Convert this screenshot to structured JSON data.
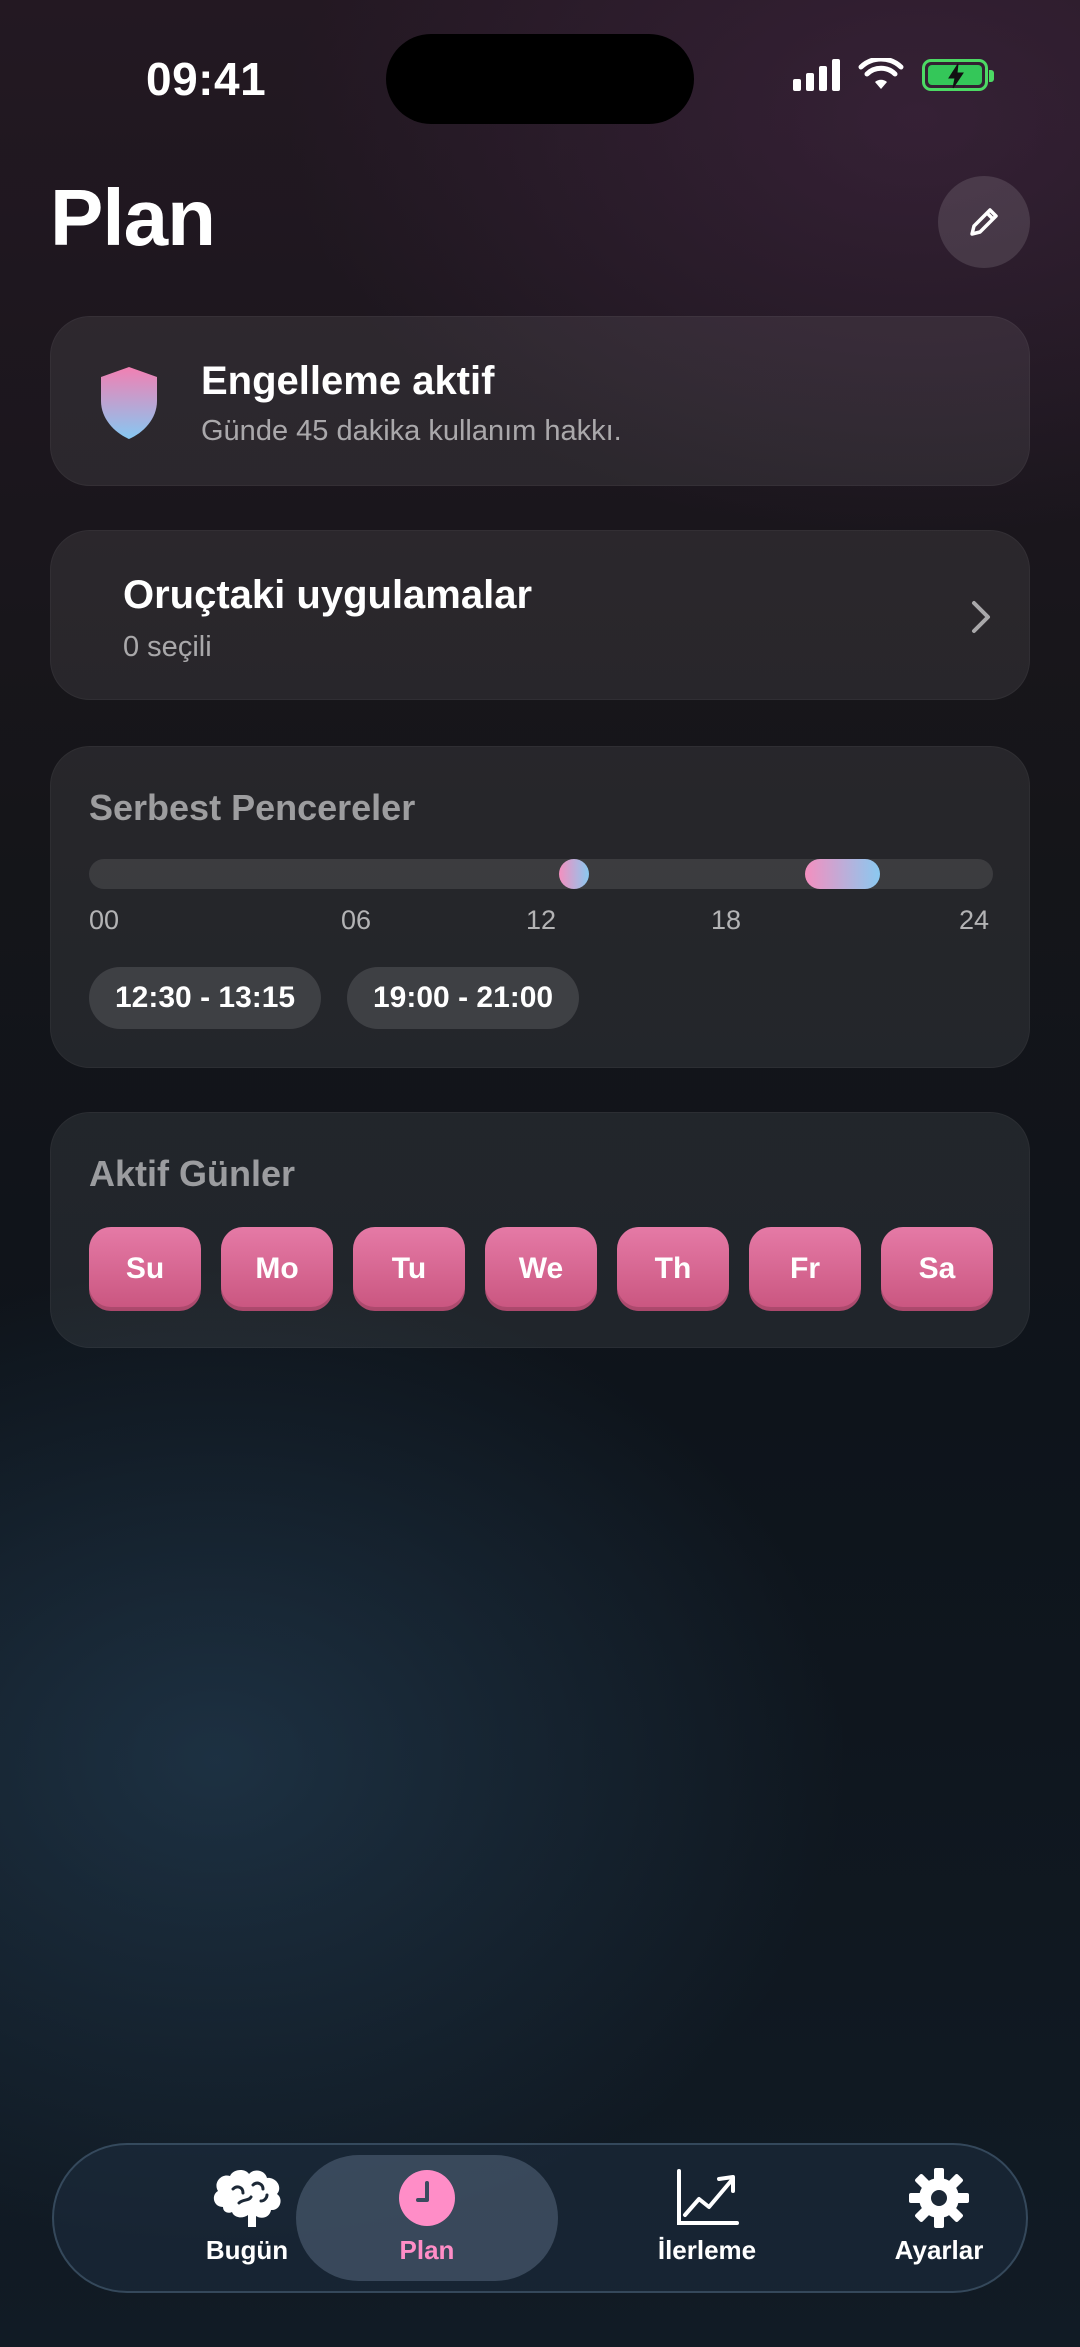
{
  "status_bar": {
    "time": "09:41"
  },
  "header": {
    "title": "Plan",
    "edit_icon": "pencil-icon"
  },
  "blocking": {
    "title": "Engelleme aktif",
    "subtitle": "Günde 45 dakika kullanım hakkı.",
    "icon": "shield-icon"
  },
  "fasting_apps": {
    "title": "Oruçtaki uygulamalar",
    "subtitle": "0 seçili"
  },
  "free_windows": {
    "title": "Serbest Pencereler",
    "ticks": [
      "00",
      "06",
      "12",
      "18",
      "24"
    ],
    "windows": [
      {
        "label": "12:30 - 13:15",
        "start_hour": 12.5,
        "end_hour": 13.25
      },
      {
        "label": "19:00 - 21:00",
        "start_hour": 19.0,
        "end_hour": 21.0
      }
    ]
  },
  "active_days": {
    "title": "Aktif Günler",
    "days": [
      "Su",
      "Mo",
      "Tu",
      "We",
      "Th",
      "Fr",
      "Sa"
    ]
  },
  "tabbar": {
    "active": "Plan",
    "tabs": [
      {
        "label": "Bugün",
        "icon": "brain-icon"
      },
      {
        "label": "Plan",
        "icon": "clock-icon"
      },
      {
        "label": "İlerleme",
        "icon": "chart-line-icon"
      },
      {
        "label": "Ayarlar",
        "icon": "gear-icon"
      }
    ]
  },
  "colors": {
    "accent_pink": "#ff8dc7",
    "day_pill": "#d9628f",
    "gradient_end": "#8ac9f0"
  }
}
